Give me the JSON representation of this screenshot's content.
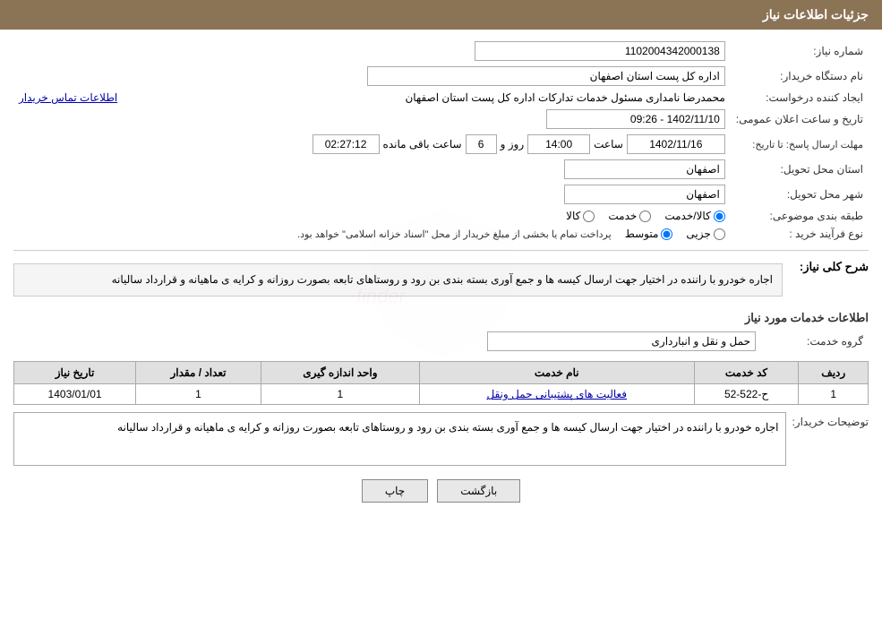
{
  "header": {
    "title": "جزئیات اطلاعات نیاز"
  },
  "fields": {
    "need_number_label": "شماره نیاز:",
    "need_number_value": "1102004342000138",
    "buyer_org_label": "نام دستگاه خریدار:",
    "buyer_org_value": "اداره کل پست استان اصفهان",
    "creator_label": "ایجاد کننده درخواست:",
    "creator_value": "محمدرضا نامداری مسئول خدمات تدارکات اداره کل پست استان اصفهان",
    "contact_link": "اطلاعات تماس خریدار",
    "announce_date_label": "تاریخ و ساعت اعلان عمومی:",
    "announce_date_value": "1402/11/10 - 09:26",
    "reply_deadline_label": "مهلت ارسال پاسخ: تا تاریخ:",
    "reply_date_value": "1402/11/16",
    "reply_time_label": "ساعت",
    "reply_time_value": "14:00",
    "reply_days_label": "روز و",
    "reply_days_value": "6",
    "reply_remaining_label": "ساعت باقی مانده",
    "reply_remaining_value": "02:27:12",
    "province_label": "استان محل تحویل:",
    "province_value": "اصفهان",
    "city_label": "شهر محل تحویل:",
    "city_value": "اصفهان",
    "category_label": "طبقه بندی موضوعی:",
    "category_options": [
      "کالا",
      "خدمت",
      "کالا/خدمت"
    ],
    "category_selected": "کالا/خدمت",
    "process_label": "نوع فرآیند خرید :",
    "process_options": [
      "جزیی",
      "متوسط"
    ],
    "process_note": "پرداخت تمام یا بخشی از مبلغ خریدار از محل \"اسناد خزانه اسلامی\" خواهد بود.",
    "need_desc_label": "شرح کلی نیاز:",
    "need_desc_value": "اجاره خودرو با راننده در اختیار جهت ارسال کیسه ها و جمع آوری بسته بندی بن رود و روستاهای تابعه بصورت روزانه و کرایه ی ماهیانه و قرارداد سالیانه",
    "services_section_label": "اطلاعات خدمات مورد نیاز",
    "service_group_label": "گروه خدمت:",
    "service_group_value": "حمل و نقل و انبارداری",
    "table_headers": {
      "row_num": "ردیف",
      "service_code": "کد خدمت",
      "service_name": "نام خدمت",
      "unit": "واحد اندازه گیری",
      "quantity": "تعداد / مقدار",
      "date": "تاریخ نیاز"
    },
    "table_rows": [
      {
        "row": "1",
        "code": "ح-522-52",
        "name": "فعالیت های پشتیبانی حمل ونقل",
        "unit": "1",
        "quantity": "1",
        "date": "1403/01/01"
      }
    ],
    "buyer_desc_label": "توضیحات خریدار:",
    "buyer_desc_value": "اجاره خودرو با راننده در اختیار جهت ارسال کیسه ها و جمع آوری بسته بندی بن رود و روستاهای تابعه بصورت روزانه و کرایه ی ماهیانه و قرارداد سالیانه",
    "btn_back": "بازگشت",
    "btn_print": "چاپ"
  }
}
